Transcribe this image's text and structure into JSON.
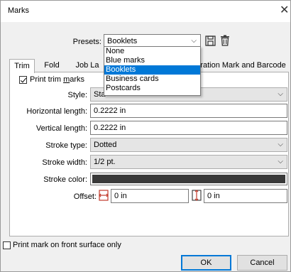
{
  "window": {
    "title": "Marks",
    "close_glyph": "✕"
  },
  "presets": {
    "label": "Presets:",
    "value": "Booklets",
    "options": [
      "None",
      "Blue marks",
      "Booklets",
      "Business cards",
      "Postcards"
    ],
    "selected_index": 2
  },
  "tabs": [
    {
      "label": "Trim"
    },
    {
      "label": "Fold"
    },
    {
      "label": "Job La"
    },
    {
      "label": "tration Mark and Barcode"
    }
  ],
  "trim": {
    "print_trim_label_pre": "Print trim ",
    "print_trim_label_u": "m",
    "print_trim_label_post": "arks",
    "print_trim_checked": true,
    "style_label": "Style:",
    "style_value": "Sta",
    "hlen_label": "Horizontal length:",
    "hlen_value": "0.2222 in",
    "vlen_label": "Vertical length:",
    "vlen_value": "0.2222 in",
    "stroke_type_label": "Stroke type:",
    "stroke_type_value": "Dotted",
    "stroke_width_label": "Stroke width:",
    "stroke_width_value": "1/2 pt.",
    "stroke_color_label": "Stroke color:",
    "stroke_color": "#3a3a3a",
    "offset_label": "Offset:",
    "offset_h_value": "0 in",
    "offset_v_value": "0 in"
  },
  "footer": {
    "front_only_label": "Print mark on front surface only",
    "front_only_checked": false,
    "ok_label": "OK",
    "cancel_label": "Cancel"
  },
  "colors": {
    "accent": "#0078d7"
  }
}
